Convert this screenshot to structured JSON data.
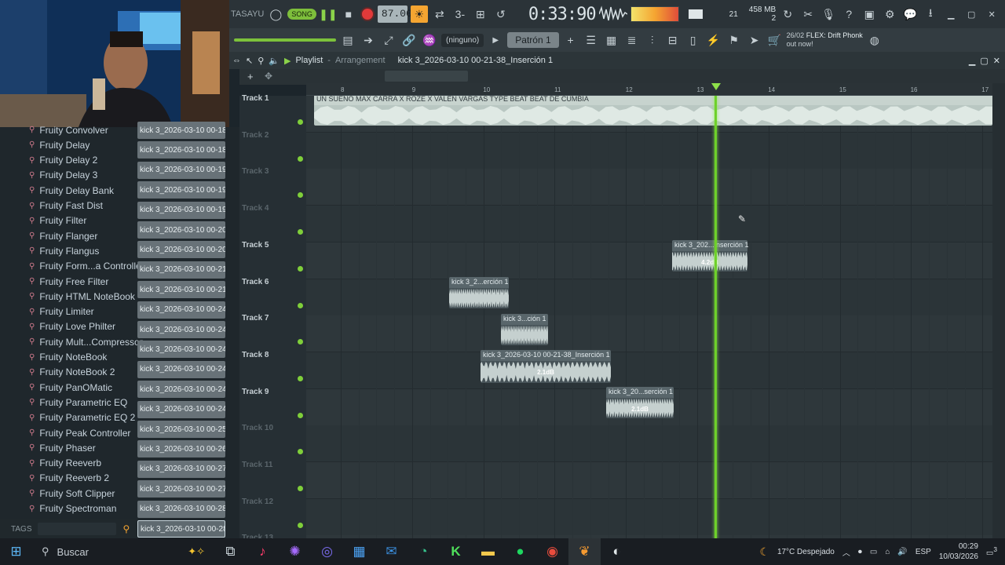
{
  "toolbar": {
    "title_fragment": "TASAYU",
    "song_mode": "SONG",
    "tempo": "87.000",
    "time_main": "0:33",
    "time_sub": "90",
    "time_unit": "M:S:CS",
    "cpu_value": "21",
    "ram": "458 MB",
    "voices": "2",
    "pattern_preset": "(ninguno)",
    "pattern_name": "Patrón 1",
    "news_date": "26/02",
    "news_title": "FLEX: Drift Phonk",
    "news_sub": "out now!"
  },
  "playlist": {
    "title": "Playlist",
    "subtitle": "Arrangement",
    "file": "kick 3_2026-03-10 00-21-38_Inserción 1",
    "ruler": [
      "8",
      "9",
      "10",
      "11",
      "12",
      "13",
      "14",
      "15",
      "16",
      "17"
    ]
  },
  "tracks": [
    {
      "label": "Track 1",
      "active": true
    },
    {
      "label": "Track 2",
      "active": false
    },
    {
      "label": "Track 3",
      "active": false
    },
    {
      "label": "Track 4",
      "active": false
    },
    {
      "label": "Track 5",
      "active": true
    },
    {
      "label": "Track 6",
      "active": true
    },
    {
      "label": "Track 7",
      "active": true
    },
    {
      "label": "Track 8",
      "active": true
    },
    {
      "label": "Track 9",
      "active": true
    },
    {
      "label": "Track 10",
      "active": false
    },
    {
      "label": "Track 11",
      "active": false
    },
    {
      "label": "Track 12",
      "active": false
    },
    {
      "label": "Track 13",
      "active": false
    }
  ],
  "clips": [
    {
      "label": "UN SUEÑO MAX CARRA X ROZE X VALEN VARGAS TYPE BEAT BEAT DE CUMBIA",
      "gain": ""
    },
    {
      "label": "kick 3_202...Inserción 1",
      "gain": "4.2dB"
    },
    {
      "label": "kick 3_2...erción 1",
      "gain": ""
    },
    {
      "label": "kick 3...ción 1",
      "gain": ""
    },
    {
      "label": "kick 3_2026-03-10 00-21-38_Inserción 1",
      "gain": "2.1dB"
    },
    {
      "label": "kick 3_20...serción 1",
      "gain": "2.1dB"
    }
  ],
  "browser": {
    "plugins": [
      "Fruity Convolver",
      "Fruity Delay",
      "Fruity Delay 2",
      "Fruity Delay 3",
      "Fruity Delay Bank",
      "Fruity Fast Dist",
      "Fruity Filter",
      "Fruity Flanger",
      "Fruity Flangus",
      "Fruity Form...a Controller",
      "Fruity Free Filter",
      "Fruity HTML NoteBook",
      "Fruity Limiter",
      "Fruity Love Philter",
      "Fruity Mult...Compressor",
      "Fruity NoteBook",
      "Fruity NoteBook 2",
      "Fruity PanOMatic",
      "Fruity Parametric EQ",
      "Fruity Parametric EQ 2",
      "Fruity Peak Controller",
      "Fruity Phaser",
      "Fruity Reeverb",
      "Fruity Reeverb 2",
      "Fruity Soft Clipper",
      "Fruity Spectroman"
    ],
    "files": [
      "kick 3_2026-03-10 00-18...",
      "kick 3_2026-03-10 00-18...",
      "kick 3_2026-03-10 00-19...",
      "kick 3_2026-03-10 00-19...",
      "kick 3_2026-03-10 00-19...",
      "kick 3_2026-03-10 00-20...",
      "kick 3_2026-03-10 00-20...",
      "kick 3_2026-03-10 00-21...",
      "kick 3_2026-03-10 00-21...",
      "kick 3_2026-03-10 00-24...",
      "kick 3_2026-03-10 00-24...",
      "kick 3_2026-03-10 00-24...",
      "kick 3_2026-03-10 00-24...",
      "kick 3_2026-03-10 00-24...",
      "kick 3_2026-03-10 00-24...",
      "kick 3_2026-03-10 00-25...",
      "kick 3_2026-03-10 00-26...",
      "kick 3_2026-03-10 00-27...",
      "kick 3_2026-03-10 00-27...",
      "kick 3_2026-03-10 00-28...",
      "kick 3_2026-03-10 00-28..."
    ],
    "tags_label": "TAGS"
  },
  "taskbar": {
    "search_placeholder": "Buscar",
    "weather": "17°C  Despejado",
    "lang": "ESP",
    "time": "00:29",
    "date": "10/03/2026",
    "notif_count": "3"
  },
  "colors": {
    "accent": "#f5a531",
    "playhead": "#6ed12a",
    "clip": "#59666b"
  }
}
